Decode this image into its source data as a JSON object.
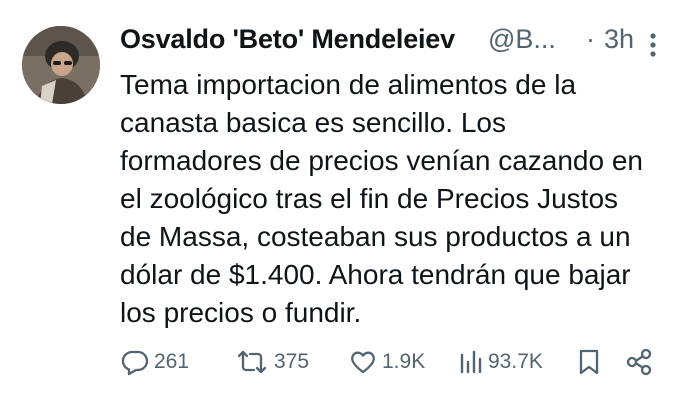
{
  "author": {
    "name": "Osvaldo 'Beto' Mendeleiev",
    "handle": "@B...",
    "separator": "·",
    "time": "3h"
  },
  "tweet": {
    "lines": [
      "Tema importacion de alimentos de la",
      "canasta basica es sencillo. Los",
      "formadores de precios venían cazando en",
      "el zoológico tras el fin de Precios Justos",
      "de Massa, costeaban sus productos a un",
      "dólar de $1.400. Ahora tendrán que bajar",
      "los precios o fundir."
    ]
  },
  "actions": {
    "replies": "261",
    "retweets": "375",
    "likes": "1.9K",
    "views": "93.7K"
  },
  "icons": {
    "more": "more-vertical-icon",
    "reply": "reply-icon",
    "retweet": "retweet-icon",
    "like": "heart-icon",
    "views": "views-chart-icon",
    "bookmark": "bookmark-icon",
    "share": "share-icon"
  },
  "colors": {
    "text": "#0f1419",
    "muted": "#536471",
    "background": "#ffffff"
  }
}
